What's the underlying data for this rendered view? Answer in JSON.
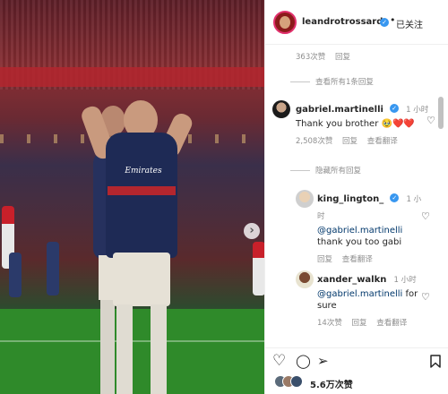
{
  "post": {
    "image": {
      "description_icon": "football-celebration-photo",
      "sponsor_text": "Emirates",
      "next_icon": "›"
    }
  },
  "header": {
    "username": "leandrotrossard",
    "verified_icon": "✓",
    "separator": "•",
    "follow_status": "已关注"
  },
  "comments": {
    "top_meta": {
      "likes": "363次赞",
      "reply": "回复"
    },
    "top_view_replies": "查看所有1条回复",
    "main": {
      "username": "gabriel.martinelli",
      "time": "1 小时",
      "text": "Thank you brother 🥹❤️❤️",
      "likes": "2,508次赞",
      "reply": "回复",
      "translate": "查看翻译"
    },
    "hide_replies": "隐藏所有回复",
    "replies": [
      {
        "username": "king_lington_",
        "time": "1 小时",
        "mention": "@gabriel.martinelli",
        "text": "thank you too gabi",
        "reply": "回复",
        "translate": "查看翻译"
      },
      {
        "username": "xander_walkn",
        "time": "1 小时",
        "mention": "@gabriel.martinelli",
        "text": "for sure",
        "likes": "14次赞",
        "reply": "回复",
        "translate": "查看翻译"
      }
    ]
  },
  "actions": {
    "like_icon": "♡",
    "comment_icon": "◯",
    "share_icon": "➢",
    "save_icon": "⌑",
    "likes_count": "5.6万次赞"
  },
  "colors": {
    "accent": "#3897f0",
    "mention": "#00376b",
    "secondary_text": "#8e8e8e"
  }
}
